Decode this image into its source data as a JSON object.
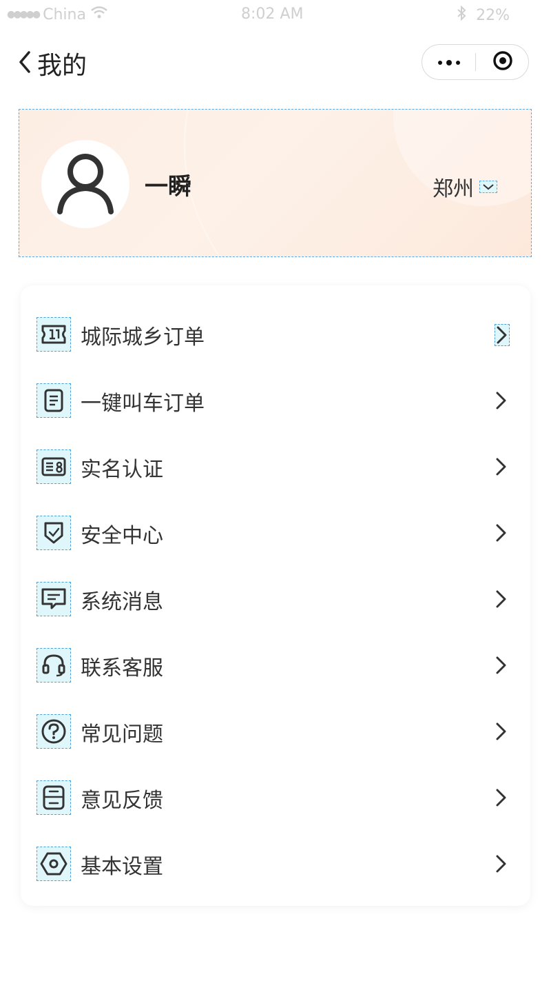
{
  "status_bar": {
    "carrier": "China",
    "time": "8:02 AM",
    "battery": "22%"
  },
  "navbar": {
    "title": "我的"
  },
  "profile": {
    "username": "一瞬",
    "city": "郑州"
  },
  "menu": {
    "items": [
      {
        "label": "城际城乡订单",
        "icon": "ticket-icon"
      },
      {
        "label": "一键叫车订单",
        "icon": "document-icon"
      },
      {
        "label": "实名认证",
        "icon": "id-card-icon"
      },
      {
        "label": "安全中心",
        "icon": "shield-check-icon"
      },
      {
        "label": "系统消息",
        "icon": "message-icon"
      },
      {
        "label": "联系客服",
        "icon": "headset-icon"
      },
      {
        "label": "常见问题",
        "icon": "question-icon"
      },
      {
        "label": "意见反馈",
        "icon": "inbox-icon"
      },
      {
        "label": "基本设置",
        "icon": "settings-hex-icon"
      }
    ]
  }
}
